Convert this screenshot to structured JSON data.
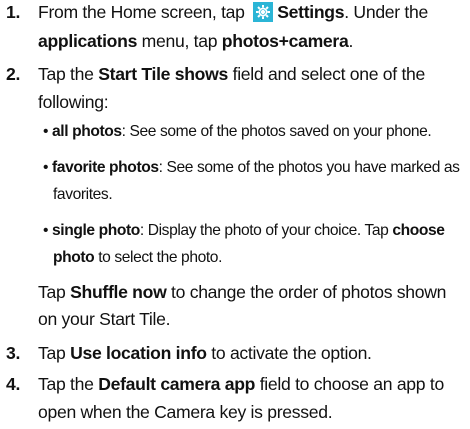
{
  "steps": [
    {
      "number": "1.",
      "line1": {
        "t1": "From the Home screen, tap ",
        "icon": "settings-gear-icon",
        "b1": "Settings",
        "t2": ". Under the"
      },
      "line2": {
        "b1": "applications",
        "t1": " menu, tap ",
        "b2": "photos+camera",
        "t2": "."
      }
    },
    {
      "number": "2.",
      "line1": {
        "t1": "Tap the ",
        "b1": "Start Tile shows",
        "t2": " field and select one of the"
      },
      "line2": {
        "t1": "following:"
      },
      "bullets": [
        {
          "b": "all photos",
          "t": ": See some of the photos saved on your phone."
        },
        {
          "b": "favorite photos",
          "t": ": See some of the photos you have marked as",
          "cont": "favorites."
        },
        {
          "b": "single photo",
          "t": ": Display the photo of your choice. Tap ",
          "b2": "choose",
          "cont_b": "photo",
          "cont_t": " to select the photo."
        }
      ],
      "after1": {
        "t1": "Tap ",
        "b1": "Shuffle now",
        "t2": " to change the order of photos shown"
      },
      "after2": {
        "t1": "on your Start Tile."
      }
    },
    {
      "number": "3.",
      "line1": {
        "t1": "Tap ",
        "b1": "Use location info",
        "t2": " to activate the option."
      }
    },
    {
      "number": "4.",
      "line1": {
        "t1": "Tap the ",
        "b1": "Default camera app",
        "t2": " field to choose an app to"
      },
      "line2": {
        "t1": "open when the Camera key is pressed."
      }
    }
  ]
}
